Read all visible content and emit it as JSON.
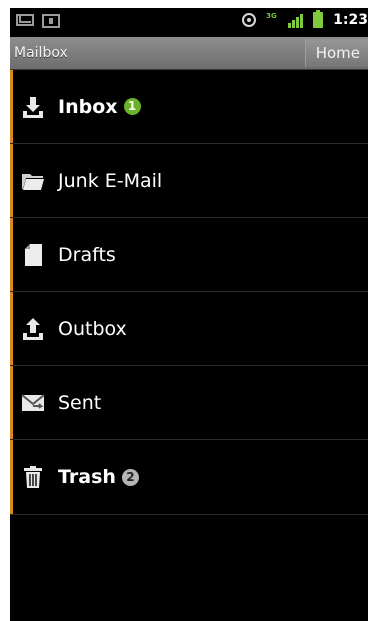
{
  "status_bar": {
    "time": "1:23",
    "data_indicator": "3G"
  },
  "header": {
    "title": "Mailbox",
    "home_label": "Home"
  },
  "folders": [
    {
      "label": "Inbox",
      "icon": "inbox-download-icon",
      "bold": true,
      "badge": "1",
      "badge_color": "#6ab226"
    },
    {
      "label": "Junk E-Mail",
      "icon": "folder-icon",
      "bold": false,
      "badge": ""
    },
    {
      "label": "Drafts",
      "icon": "document-icon",
      "bold": false,
      "badge": ""
    },
    {
      "label": "Outbox",
      "icon": "upload-icon",
      "bold": false,
      "badge": ""
    },
    {
      "label": "Sent",
      "icon": "sent-mail-icon",
      "bold": false,
      "badge": ""
    },
    {
      "label": "Trash",
      "icon": "trash-icon",
      "bold": true,
      "badge": "2",
      "badge_color": "#b4b4b4"
    }
  ],
  "colors": {
    "accent": "#d98a1e",
    "background": "#000000",
    "title_bar": "#7a7a7a",
    "status_green": "#7fc93f"
  }
}
